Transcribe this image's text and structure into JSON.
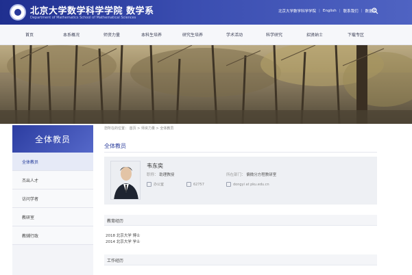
{
  "header": {
    "title": "北京大学数学科学学院 数学系",
    "subtitle": "Department of Mathematics School of Mathematical Sciences",
    "links": [
      {
        "label": "北京大学数学科学学院"
      },
      {
        "label": "English"
      },
      {
        "label": "联系我们"
      },
      {
        "label": "数据库"
      }
    ]
  },
  "nav": {
    "items": [
      {
        "label": "首页"
      },
      {
        "label": "本系概况"
      },
      {
        "label": "师资力量"
      },
      {
        "label": "本科生培养"
      },
      {
        "label": "研究生培养"
      },
      {
        "label": "学术活动"
      },
      {
        "label": "科学研究"
      },
      {
        "label": "招贤纳士"
      },
      {
        "label": "下载专区"
      }
    ]
  },
  "sidebar": {
    "title": "全体教员",
    "items": [
      {
        "label": "全体教员",
        "active": true
      },
      {
        "label": "杰出人才"
      },
      {
        "label": "访问学者"
      },
      {
        "label": "教研室"
      },
      {
        "label": "教辅行政"
      }
    ]
  },
  "breadcrumb": "您所在的位置： 首页 > 师资力量 > 全体教员",
  "main": {
    "title": "全体教员",
    "profile": {
      "name": "韦东奕",
      "title_label": "职称：",
      "title_value": "助理教授",
      "dept_label": "所在部门：",
      "dept_value": "偏微分方程教研室",
      "office_label": "办公室",
      "office_value": "办公室",
      "phone_value": "62757",
      "email_value": "dongyi at pku.edu.cn"
    },
    "education_heading": "教育经历",
    "education": [
      "2018 北京大学 博士",
      "2014 北京大学 学士"
    ],
    "work_heading": "工作经历"
  }
}
